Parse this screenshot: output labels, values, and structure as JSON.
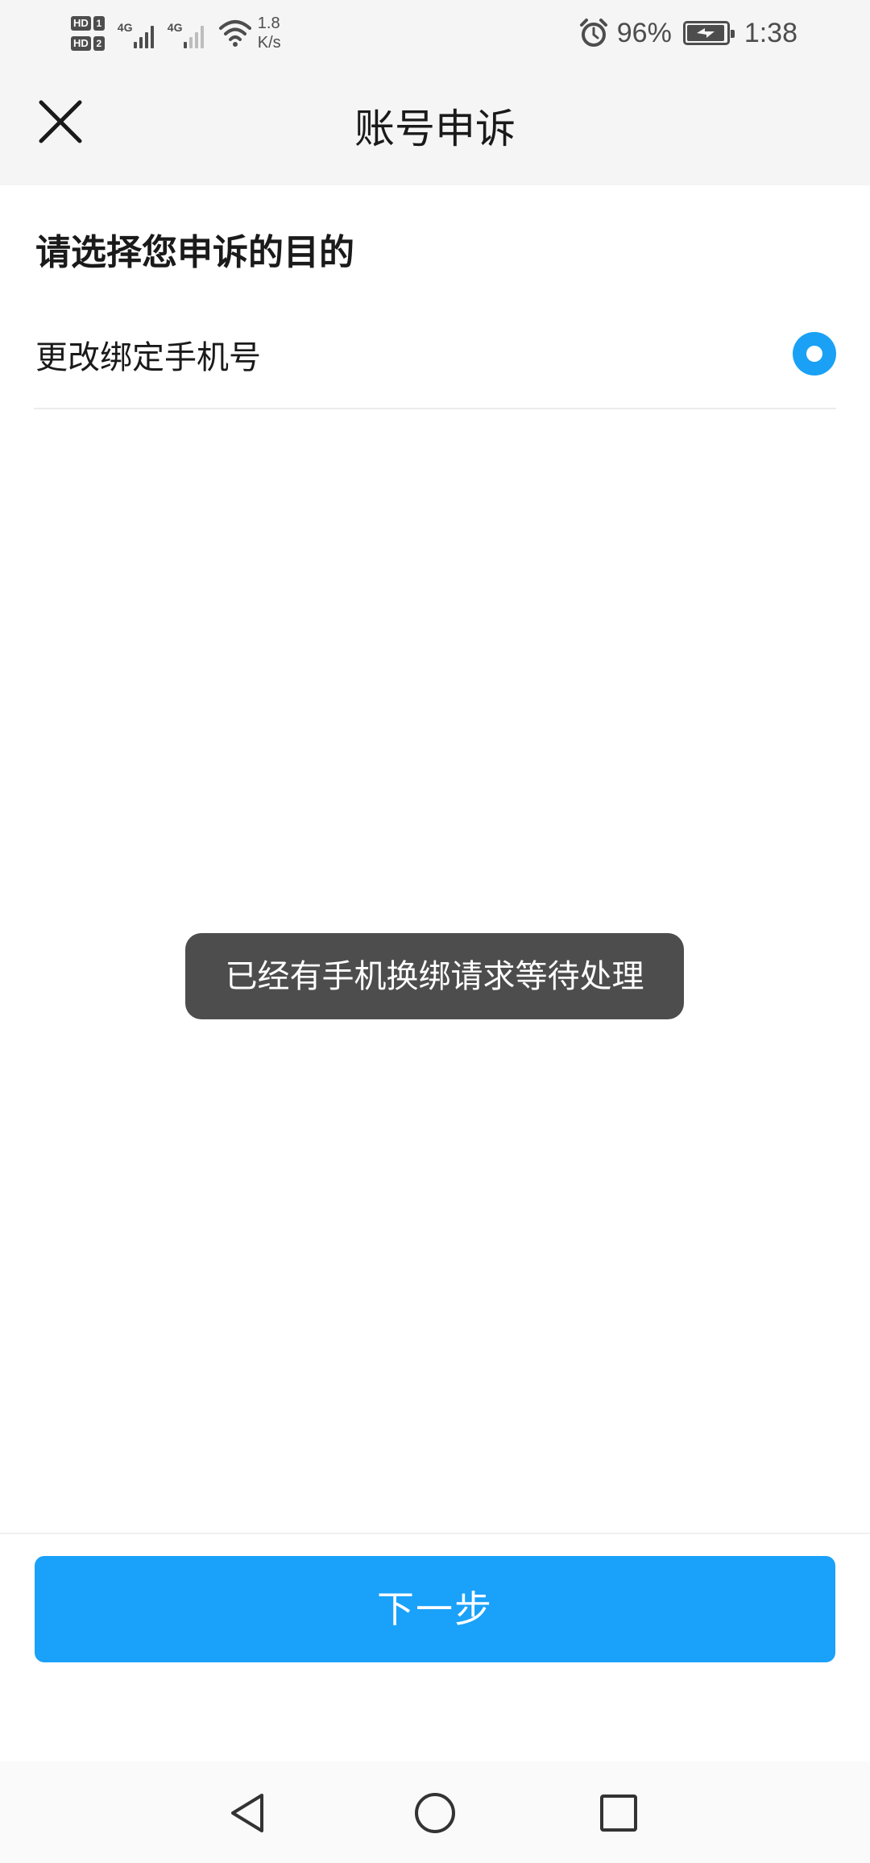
{
  "status_bar": {
    "sim1_label": "HD",
    "sim1_num": "1",
    "sim2_label": "HD",
    "sim2_num": "2",
    "net1_type": "4G",
    "net2_type": "4G",
    "speed_value": "1.8",
    "speed_unit": "K/s",
    "battery_percent": "96%",
    "battery_level": 0.96,
    "time": "1:38",
    "icons": [
      "signal-icon",
      "wifi-icon",
      "alarm-icon",
      "battery-charging-icon"
    ]
  },
  "header": {
    "close_icon": "close-icon",
    "title": "账号申诉"
  },
  "form": {
    "section_title": "请选择您申诉的目的",
    "options": [
      {
        "label": "更改绑定手机号",
        "selected": true
      }
    ]
  },
  "toast": {
    "message": "已经有手机换绑请求等待处理"
  },
  "footer": {
    "next_label": "下一步"
  },
  "nav_bar": {
    "icons": [
      "back-icon",
      "home-icon",
      "recents-icon"
    ]
  },
  "colors": {
    "accent": "#1aa1fa",
    "toast_bg": "#4d4d4d",
    "header_bg": "#f5f5f5",
    "text_primary": "#1a1a1a"
  }
}
